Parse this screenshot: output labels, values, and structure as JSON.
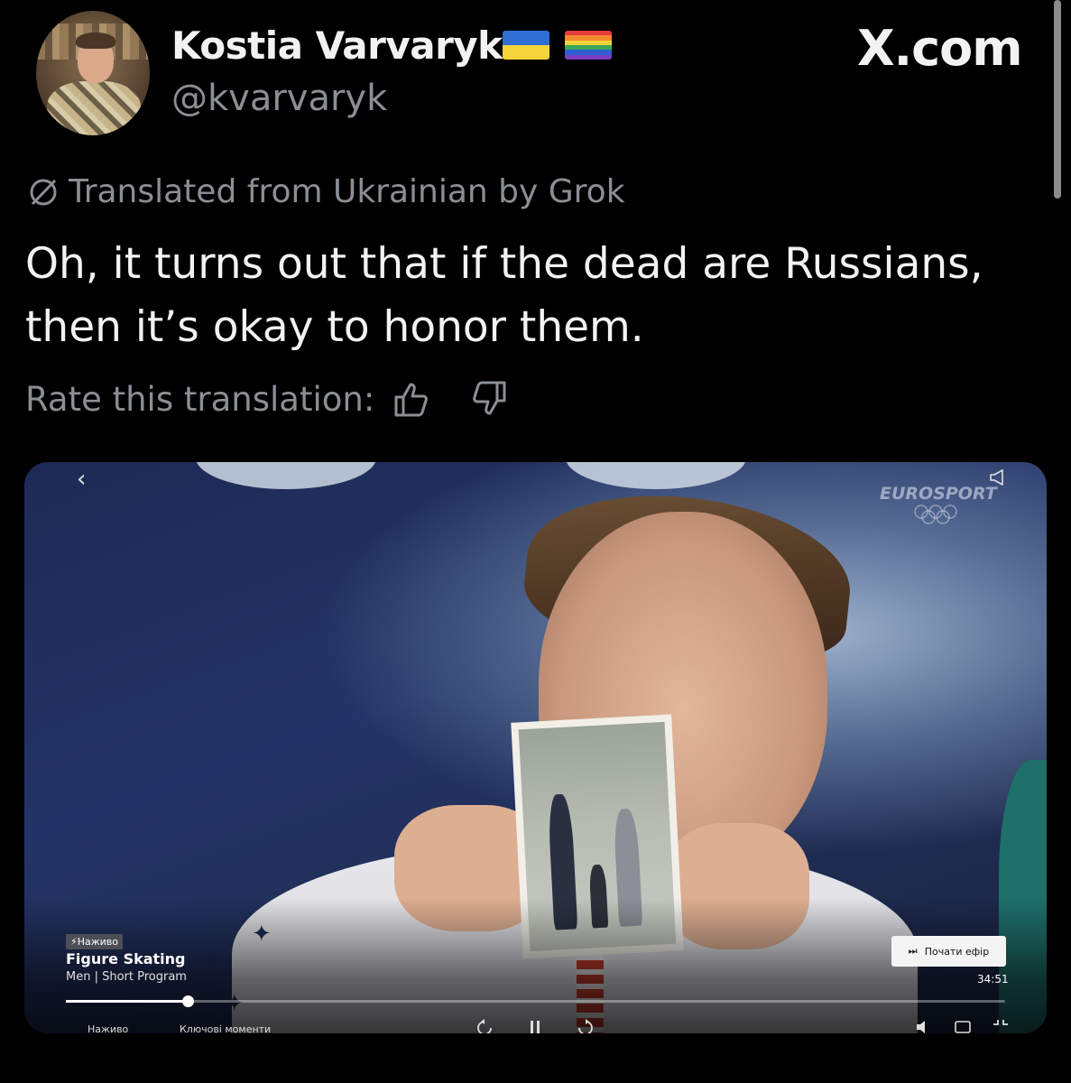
{
  "profile": {
    "name": "Kostia Varvaryk",
    "handle": "@kvarvaryk",
    "flags": [
      "ukraine-flag",
      "pride-flag"
    ]
  },
  "brand": "X.com",
  "translation_notice": "Translated from Ukrainian by Grok",
  "tweet_text": "Oh, it turns out that if the dead are Russians, then it’s okay to honor them.",
  "rate": {
    "label": "Rate this translation:",
    "icons": [
      "thumbs-up-icon",
      "thumbs-down-icon"
    ]
  },
  "video": {
    "channel": "EUROSPORT",
    "live_badge": "⚡Наживо",
    "title": "Figure Skating",
    "subtitle": "Men | Short Program",
    "start_button": "Почати ефір",
    "duration": "34:51",
    "progress": 0.13,
    "bottom_labels": [
      "Наживо",
      "Ключові моменти"
    ]
  },
  "colors": {
    "background": "#000000",
    "text_primary": "#f2f2f2",
    "text_secondary": "#8b8f94"
  }
}
